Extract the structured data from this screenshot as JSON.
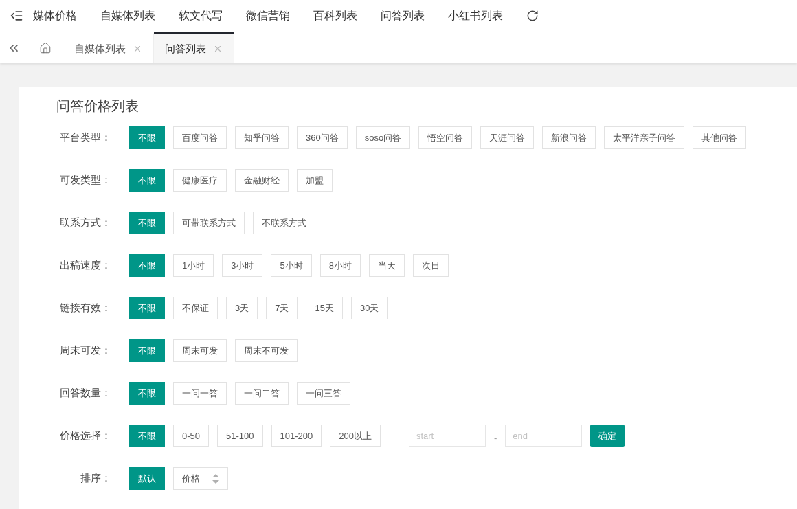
{
  "nav": {
    "items": [
      "媒体价格",
      "自媒体列表",
      "软文代写",
      "微信营销",
      "百科列表",
      "问答列表",
      "小红书列表"
    ]
  },
  "tabs": [
    {
      "label": "自媒体列表",
      "selected": false
    },
    {
      "label": "问答列表",
      "selected": true
    }
  ],
  "panel": {
    "title": "问答价格列表",
    "filters": [
      {
        "label": "平台类型：",
        "options": [
          {
            "text": "不限",
            "selected": true
          },
          {
            "text": "百度问答",
            "selected": false
          },
          {
            "text": "知乎问答",
            "selected": false
          },
          {
            "text": "360问答",
            "selected": false
          },
          {
            "text": "soso问答",
            "selected": false
          },
          {
            "text": "悟空问答",
            "selected": false
          },
          {
            "text": "天涯问答",
            "selected": false
          },
          {
            "text": "新浪问答",
            "selected": false
          },
          {
            "text": "太平洋亲子问答",
            "selected": false
          },
          {
            "text": "其他问答",
            "selected": false
          }
        ]
      },
      {
        "label": "可发类型：",
        "options": [
          {
            "text": "不限",
            "selected": true
          },
          {
            "text": "健康医疗",
            "selected": false
          },
          {
            "text": "金融财经",
            "selected": false
          },
          {
            "text": "加盟",
            "selected": false
          }
        ]
      },
      {
        "label": "联系方式：",
        "options": [
          {
            "text": "不限",
            "selected": true
          },
          {
            "text": "可带联系方式",
            "selected": false
          },
          {
            "text": "不联系方式",
            "selected": false
          }
        ]
      },
      {
        "label": "出稿速度：",
        "options": [
          {
            "text": "不限",
            "selected": true
          },
          {
            "text": "1小时",
            "selected": false
          },
          {
            "text": "3小时",
            "selected": false
          },
          {
            "text": "5小时",
            "selected": false
          },
          {
            "text": "8小时",
            "selected": false
          },
          {
            "text": "当天",
            "selected": false
          },
          {
            "text": "次日",
            "selected": false
          }
        ]
      },
      {
        "label": "链接有效：",
        "options": [
          {
            "text": "不限",
            "selected": true
          },
          {
            "text": "不保证",
            "selected": false
          },
          {
            "text": "3天",
            "selected": false
          },
          {
            "text": "7天",
            "selected": false
          },
          {
            "text": "15天",
            "selected": false
          },
          {
            "text": "30天",
            "selected": false
          }
        ]
      },
      {
        "label": "周末可发：",
        "options": [
          {
            "text": "不限",
            "selected": true
          },
          {
            "text": "周末可发",
            "selected": false
          },
          {
            "text": "周末不可发",
            "selected": false
          }
        ]
      },
      {
        "label": "回答数量：",
        "options": [
          {
            "text": "不限",
            "selected": true
          },
          {
            "text": "一问一答",
            "selected": false
          },
          {
            "text": "一问二答",
            "selected": false
          },
          {
            "text": "一问三答",
            "selected": false
          }
        ]
      },
      {
        "label": "价格选择：",
        "options": [
          {
            "text": "不限",
            "selected": true
          },
          {
            "text": "0-50",
            "selected": false
          },
          {
            "text": "51-100",
            "selected": false
          },
          {
            "text": "101-200",
            "selected": false
          },
          {
            "text": "200以上",
            "selected": false
          }
        ],
        "range": {
          "start_placeholder": "start",
          "separator": "-",
          "end_placeholder": "end",
          "button": "确定"
        }
      },
      {
        "label": "排序：",
        "options": [
          {
            "text": "默认",
            "selected": true,
            "kind": "plain"
          },
          {
            "text": "价格",
            "selected": false,
            "kind": "sort"
          }
        ]
      }
    ]
  }
}
